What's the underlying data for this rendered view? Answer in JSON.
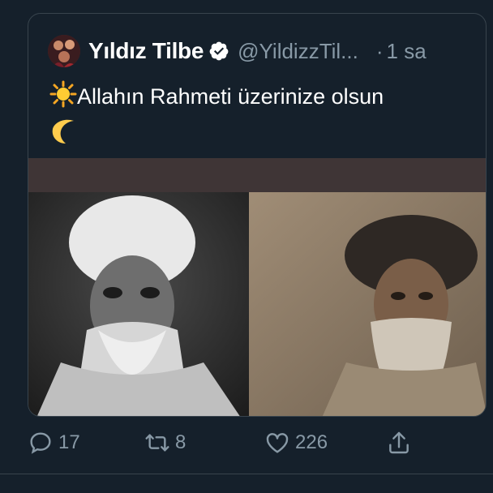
{
  "quoted_tweet": {
    "display_name": "Yıldız Tilbe",
    "handle": "@YildizzTil...",
    "separator": "·",
    "time": "1 sa",
    "text": "Allahın Rahmeti üzerinize olsun",
    "emoji_before": "sun-emoji",
    "emoji_after": "crescent-moon-emoji",
    "verified": true
  },
  "actions": {
    "reply_count": "17",
    "retweet_count": "8",
    "like_count": "226"
  },
  "colors": {
    "background": "#15202b",
    "border": "#38444d",
    "secondary_text": "#8899a6",
    "primary_text": "#ffffff"
  }
}
